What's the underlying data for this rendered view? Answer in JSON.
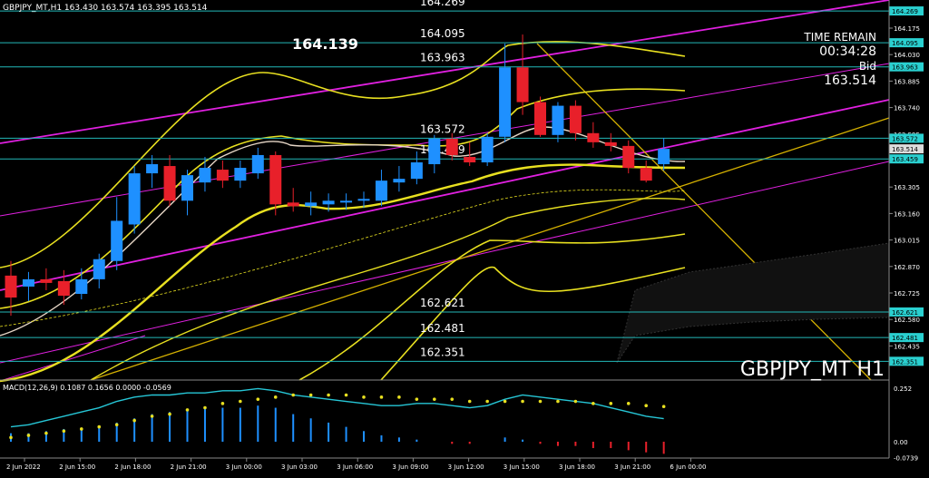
{
  "window": {
    "header": "GBPJPY_MT,H1  163.430 163.574 163.395 163.514",
    "symbol_label": "GBPJPY_MT H1",
    "time_remain_label": "TIME REMAIN",
    "time_remain_value": "00:34:28",
    "bid_label": "Bid",
    "bid_value": "163.514",
    "big_price": "164.139"
  },
  "colors": {
    "background": "#000000",
    "bull": "#1e90ff",
    "bear": "#e8202a",
    "hline": "#23b9b9",
    "channel_magenta": "#e020e0",
    "bollinger_yellow": "#e8e020",
    "trend_gold": "#d4b000",
    "ma_white": "#e6d6c6",
    "macd_line": "#26c6d6",
    "macd_signal": "#e8e020",
    "axis_text": "#ffffff"
  },
  "chart_data": [
    {
      "type": "candlestick",
      "title": "GBPJPY_MT,H1",
      "y_ticks": [
        "164.175",
        "164.030",
        "163.885",
        "163.740",
        "163.595",
        "163.450",
        "163.305",
        "163.160",
        "163.015",
        "162.870",
        "162.725",
        "162.580",
        "162.435"
      ],
      "ylim": [
        162.41,
        164.33
      ],
      "x_ticks": [
        "2 Jun 2022",
        "2 Jun 15:00",
        "2 Jun 18:00",
        "2 Jun 21:00",
        "3 Jun 00:00",
        "3 Jun 03:00",
        "3 Jun 06:00",
        "3 Jun 09:00",
        "3 Jun 12:00",
        "3 Jun 15:00",
        "3 Jun 18:00",
        "3 Jun 21:00",
        "6 Jun 00:00"
      ],
      "horizontal_levels": [
        {
          "price": "164.269",
          "label": "164.269"
        },
        {
          "price": "164.095",
          "label": "164.095"
        },
        {
          "price": "163.963",
          "label": "163.963"
        },
        {
          "price": "163.572",
          "label": "163.572"
        },
        {
          "price": "163.459",
          "label": "163.459"
        },
        {
          "price": "162.621",
          "label": "162.621"
        },
        {
          "price": "162.481",
          "label": "162.481"
        },
        {
          "price": "162.351",
          "label": "162.351"
        }
      ],
      "candles": [
        {
          "o": 162.82,
          "h": 162.9,
          "l": 162.6,
          "c": 162.7
        },
        {
          "o": 162.76,
          "h": 162.84,
          "l": 162.68,
          "c": 162.8
        },
        {
          "o": 162.8,
          "h": 162.86,
          "l": 162.74,
          "c": 162.78
        },
        {
          "o": 162.79,
          "h": 162.85,
          "l": 162.66,
          "c": 162.71
        },
        {
          "o": 162.72,
          "h": 162.86,
          "l": 162.69,
          "c": 162.8
        },
        {
          "o": 162.8,
          "h": 162.94,
          "l": 162.75,
          "c": 162.91
        },
        {
          "o": 162.9,
          "h": 163.25,
          "l": 162.85,
          "c": 163.12
        },
        {
          "o": 163.1,
          "h": 163.42,
          "l": 163.05,
          "c": 163.38
        },
        {
          "o": 163.38,
          "h": 163.48,
          "l": 163.3,
          "c": 163.43
        },
        {
          "o": 163.42,
          "h": 163.48,
          "l": 163.2,
          "c": 163.23
        },
        {
          "o": 163.23,
          "h": 163.4,
          "l": 163.15,
          "c": 163.37
        },
        {
          "o": 163.33,
          "h": 163.47,
          "l": 163.28,
          "c": 163.41
        },
        {
          "o": 163.4,
          "h": 163.45,
          "l": 163.3,
          "c": 163.34
        },
        {
          "o": 163.34,
          "h": 163.45,
          "l": 163.3,
          "c": 163.41
        },
        {
          "o": 163.38,
          "h": 163.52,
          "l": 163.35,
          "c": 163.48
        },
        {
          "o": 163.48,
          "h": 163.5,
          "l": 163.15,
          "c": 163.21
        },
        {
          "o": 163.22,
          "h": 163.3,
          "l": 163.17,
          "c": 163.2
        },
        {
          "o": 163.2,
          "h": 163.28,
          "l": 163.15,
          "c": 163.22
        },
        {
          "o": 163.21,
          "h": 163.27,
          "l": 163.17,
          "c": 163.23
        },
        {
          "o": 163.22,
          "h": 163.27,
          "l": 163.18,
          "c": 163.23
        },
        {
          "o": 163.23,
          "h": 163.28,
          "l": 163.19,
          "c": 163.24
        },
        {
          "o": 163.23,
          "h": 163.4,
          "l": 163.2,
          "c": 163.34
        },
        {
          "o": 163.33,
          "h": 163.42,
          "l": 163.28,
          "c": 163.35
        },
        {
          "o": 163.35,
          "h": 163.5,
          "l": 163.32,
          "c": 163.44
        },
        {
          "o": 163.43,
          "h": 163.59,
          "l": 163.38,
          "c": 163.57
        },
        {
          "o": 163.57,
          "h": 163.6,
          "l": 163.45,
          "c": 163.48
        },
        {
          "o": 163.47,
          "h": 163.55,
          "l": 163.42,
          "c": 163.44
        },
        {
          "o": 163.44,
          "h": 163.6,
          "l": 163.42,
          "c": 163.58
        },
        {
          "o": 163.58,
          "h": 164.09,
          "l": 163.55,
          "c": 163.96
        },
        {
          "o": 163.96,
          "h": 164.14,
          "l": 163.7,
          "c": 163.77
        },
        {
          "o": 163.77,
          "h": 163.8,
          "l": 163.58,
          "c": 163.59
        },
        {
          "o": 163.59,
          "h": 163.77,
          "l": 163.55,
          "c": 163.75
        },
        {
          "o": 163.75,
          "h": 163.78,
          "l": 163.56,
          "c": 163.6
        },
        {
          "o": 163.6,
          "h": 163.66,
          "l": 163.52,
          "c": 163.55
        },
        {
          "o": 163.55,
          "h": 163.6,
          "l": 163.5,
          "c": 163.53
        },
        {
          "o": 163.53,
          "h": 163.56,
          "l": 163.38,
          "c": 163.41
        },
        {
          "o": 163.41,
          "h": 163.45,
          "l": 163.33,
          "c": 163.34
        },
        {
          "o": 163.43,
          "h": 163.574,
          "l": 163.395,
          "c": 163.514
        }
      ]
    },
    {
      "type": "bar",
      "title": "MACD(12,26,9) 0.1087 0.1656 0.0000 -0.0569",
      "y_ticks": [
        "0.252",
        "0.00",
        "-0.0739"
      ],
      "ylim": [
        -0.085,
        0.28
      ],
      "histogram": [
        0.04,
        0.04,
        0.05,
        0.06,
        0.06,
        0.07,
        0.09,
        0.11,
        0.13,
        0.14,
        0.15,
        0.16,
        0.16,
        0.16,
        0.17,
        0.16,
        0.13,
        0.11,
        0.09,
        0.07,
        0.05,
        0.03,
        0.02,
        0.01,
        0.0,
        -0.01,
        -0.01,
        0.0,
        0.02,
        0.01,
        -0.01,
        -0.02,
        -0.02,
        -0.03,
        -0.03,
        -0.04,
        -0.05,
        -0.057
      ],
      "macd": [
        0.07,
        0.08,
        0.1,
        0.12,
        0.14,
        0.16,
        0.19,
        0.21,
        0.22,
        0.22,
        0.23,
        0.23,
        0.24,
        0.24,
        0.25,
        0.24,
        0.22,
        0.21,
        0.2,
        0.19,
        0.18,
        0.17,
        0.17,
        0.18,
        0.18,
        0.17,
        0.16,
        0.17,
        0.2,
        0.22,
        0.21,
        0.2,
        0.19,
        0.18,
        0.16,
        0.14,
        0.12,
        0.1087
      ],
      "signal": [
        0.02,
        0.03,
        0.04,
        0.05,
        0.06,
        0.07,
        0.08,
        0.1,
        0.12,
        0.13,
        0.15,
        0.16,
        0.18,
        0.19,
        0.2,
        0.21,
        0.22,
        0.22,
        0.22,
        0.22,
        0.21,
        0.21,
        0.21,
        0.2,
        0.2,
        0.2,
        0.19,
        0.19,
        0.19,
        0.19,
        0.19,
        0.19,
        0.19,
        0.18,
        0.18,
        0.18,
        0.17,
        0.1656
      ]
    }
  ]
}
